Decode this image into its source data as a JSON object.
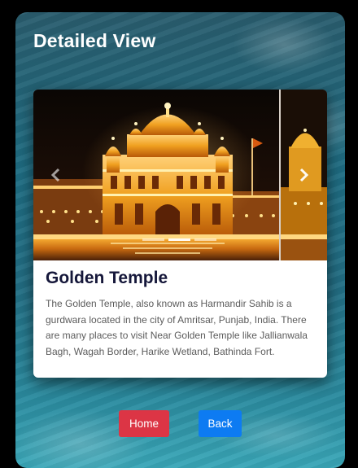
{
  "page": {
    "title": "Detailed View"
  },
  "card": {
    "title": "Golden Temple",
    "description": "The Golden Temple, also known as Harmandir Sahib is a gurdwara located in the city of Amritsar, Punjab, India. There are many places to visit Near Golden Temple like Jallianwala Bagh, Wagah Border, Harike Wetland, Bathinda Fort."
  },
  "carousel": {
    "slide_count": 3,
    "active_index": 1,
    "prev_icon": "chevron-left-icon",
    "next_icon": "chevron-right-icon"
  },
  "buttons": {
    "home_label": "Home",
    "back_label": "Back"
  },
  "colors": {
    "home_button": "#dc3545",
    "back_button": "#0d7bf2",
    "card_title": "#15173a",
    "temple_gold": "#f0a020"
  }
}
